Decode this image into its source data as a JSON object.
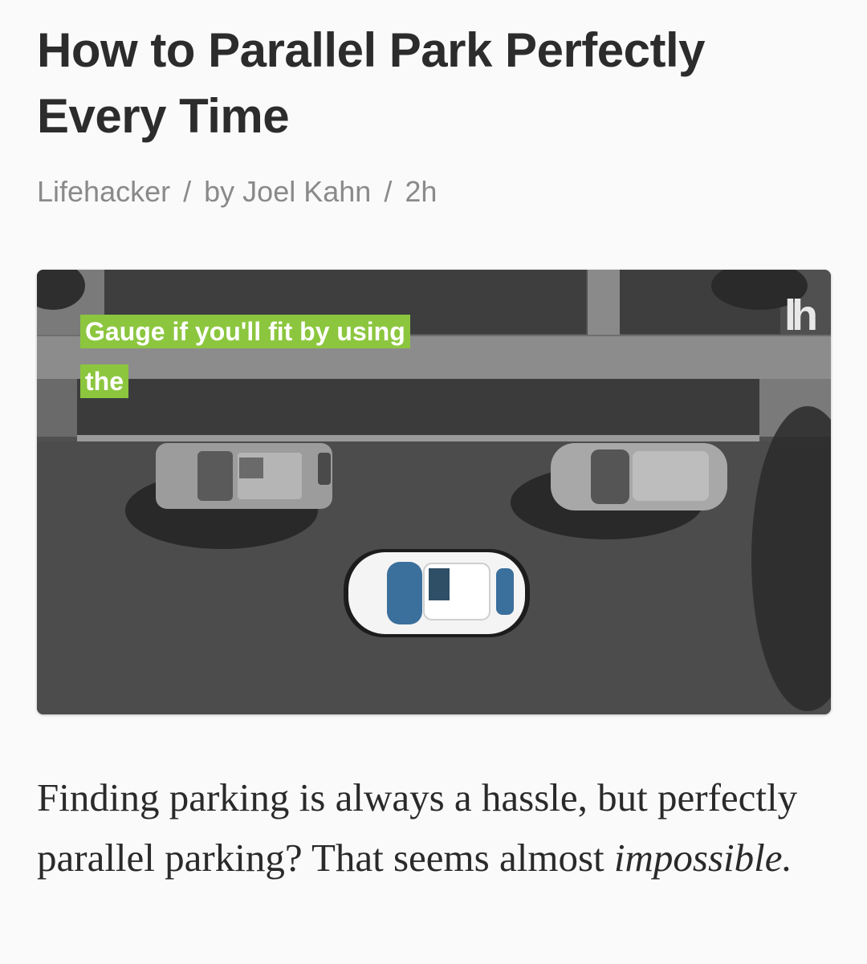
{
  "article": {
    "title": "How to Parallel Park Perfectly Every Time",
    "byline": {
      "source": "Lifehacker",
      "author": "by Joel Kahn",
      "time": "2h",
      "separator": "/"
    },
    "hero": {
      "caption_line_1": "Gauge if you'll fit by using",
      "caption_line_2": "the",
      "logo": "lh",
      "caption_color": "#8cc63f"
    },
    "body": {
      "text_start": "Finding parking is always a hassle, but perfectly parallel parking? That seems almost ",
      "text_emphasis": "impossible."
    }
  }
}
